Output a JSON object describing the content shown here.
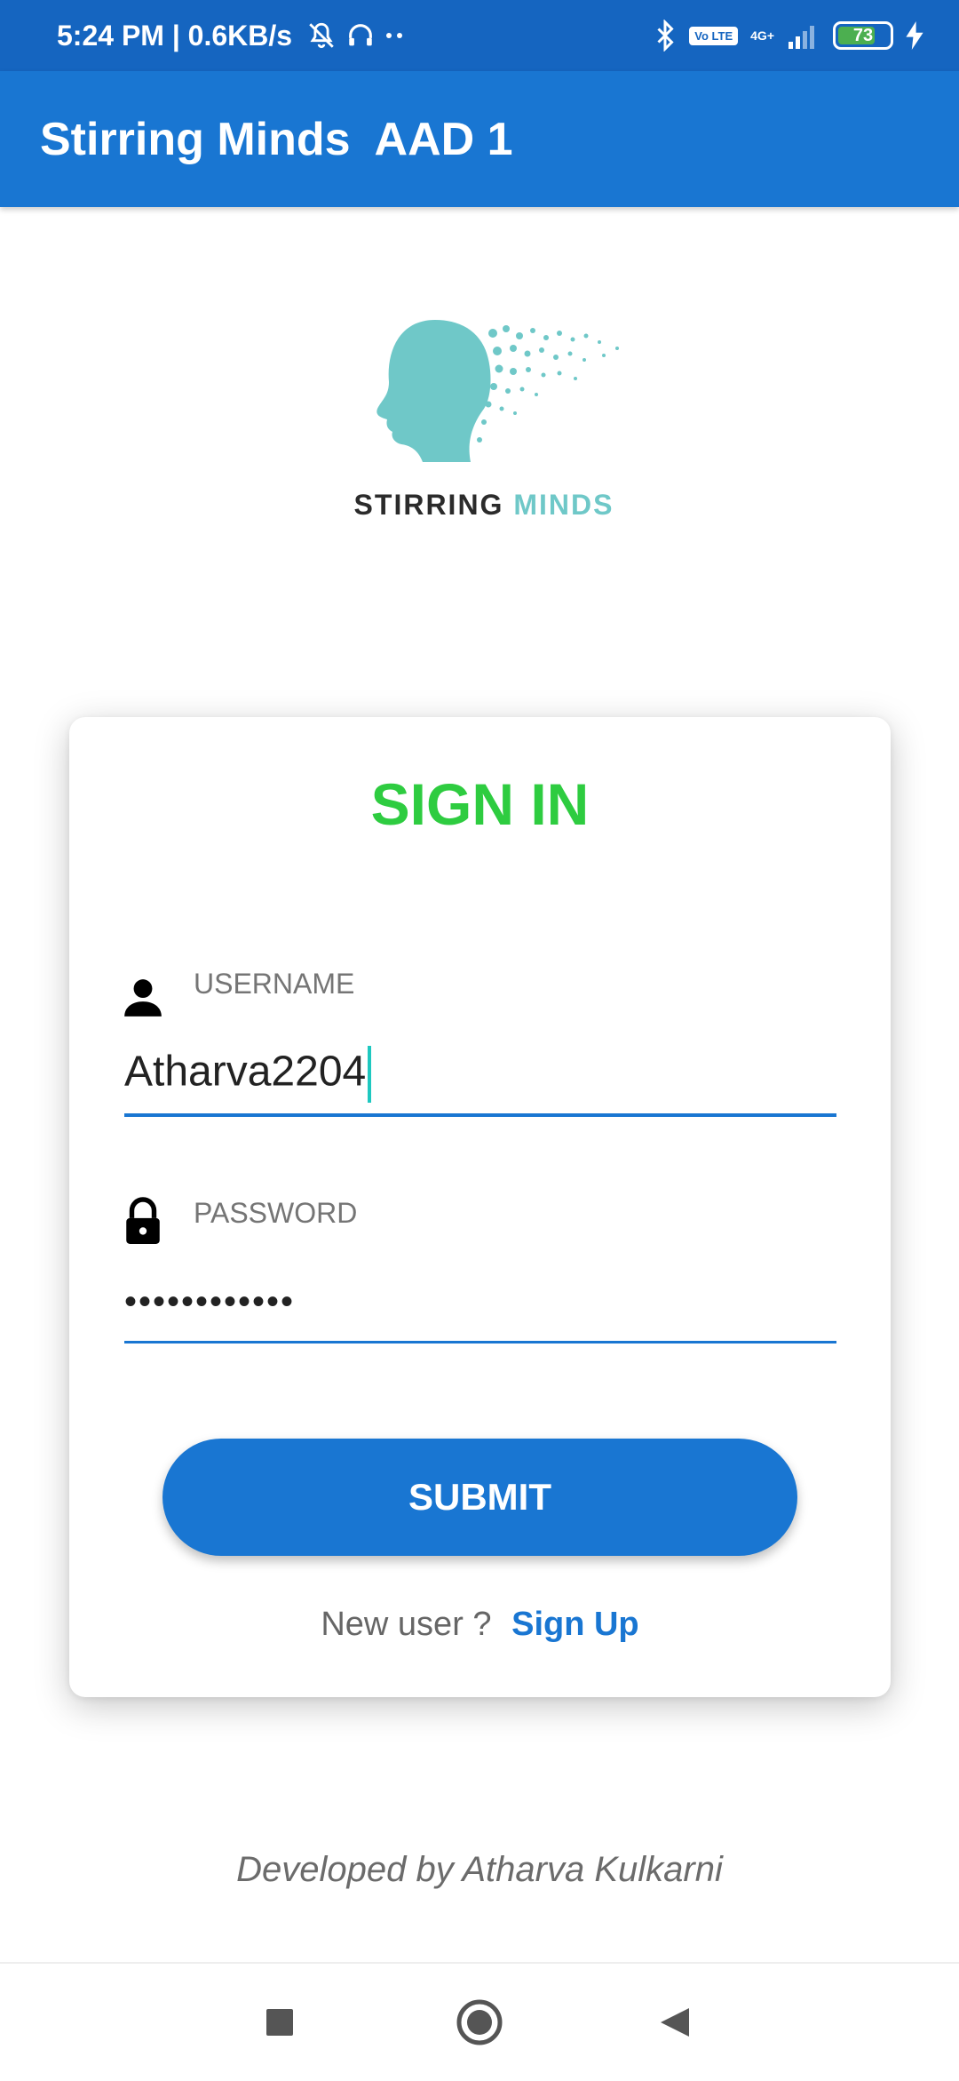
{
  "status_bar": {
    "time_speed": "5:24 PM | 0.6KB/s",
    "volte": "Vo LTE",
    "network": "4G+",
    "battery": "73",
    "battery_level_percent": 73
  },
  "app_bar": {
    "title": "Stirring Minds  AAD 1"
  },
  "logo": {
    "word1": "STIRRING",
    "word2": "MINDS",
    "word1_color": "#2b2b2b",
    "word2_color": "#6fc8c8"
  },
  "sign_in": {
    "title": "SIGN IN",
    "username_label": "USERNAME",
    "username_value": "Atharva2204",
    "password_label": "PASSWORD",
    "password_value": "••••••••••••",
    "submit_label": "SUBMIT",
    "new_user_text": "New user ?",
    "signup_link": "Sign Up"
  },
  "footer": {
    "credit": "Developed by Atharva Kulkarni"
  },
  "colors": {
    "status_bar": "#1565c0",
    "app_bar": "#1976d2",
    "accent": "#1976d2",
    "title_green": "#2ecc40"
  },
  "icons": [
    "bluetooth-icon",
    "mute-icon",
    "headset-icon",
    "user-icon",
    "lock-icon",
    "square-nav-icon",
    "circle-nav-icon",
    "back-nav-icon"
  ]
}
